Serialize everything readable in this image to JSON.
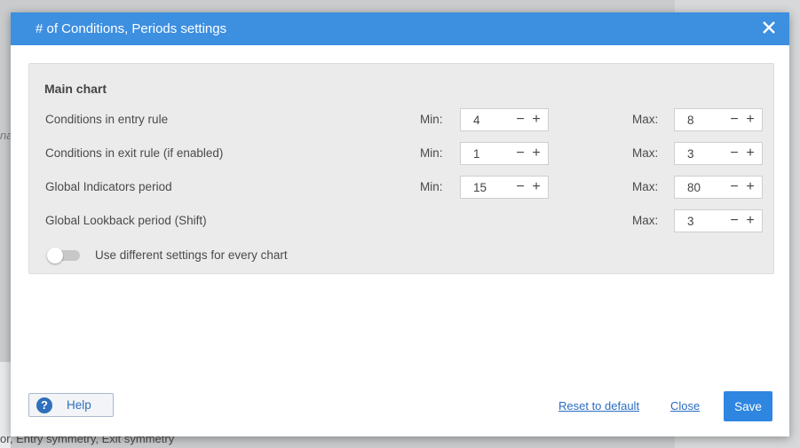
{
  "dialog": {
    "title": "# of Conditions, Periods settings",
    "close_icon": "close-icon"
  },
  "background": {
    "left_fragment": "na",
    "bottom_fragment": "or, Entry symmetry, Exit symmetry"
  },
  "main_chart": {
    "heading": "Main chart",
    "rows": [
      {
        "label": "Conditions in entry rule",
        "min_label": "Min:",
        "min": "4",
        "max_label": "Max:",
        "max": "8"
      },
      {
        "label": "Conditions in exit rule (if enabled)",
        "min_label": "Min:",
        "min": "1",
        "max_label": "Max:",
        "max": "3"
      },
      {
        "label": "Global Indicators period",
        "min_label": "Min:",
        "min": "15",
        "max_label": "Max:",
        "max": "80"
      },
      {
        "label": "Global Lookback period (Shift)",
        "max_label": "Max:",
        "max": "3"
      }
    ],
    "stepper_minus": "−",
    "stepper_plus": "+",
    "toggle": {
      "label": "Use different settings for every chart",
      "on": false
    }
  },
  "footer": {
    "help_label": "Help",
    "help_icon": "question-icon",
    "reset_label": "Reset to default",
    "close_label": "Close",
    "save_label": "Save"
  },
  "colors": {
    "titlebar": "#3d8fe0",
    "save_button": "#2f86e0",
    "link": "#2a6dc2",
    "section_bg": "#ebebeb"
  }
}
